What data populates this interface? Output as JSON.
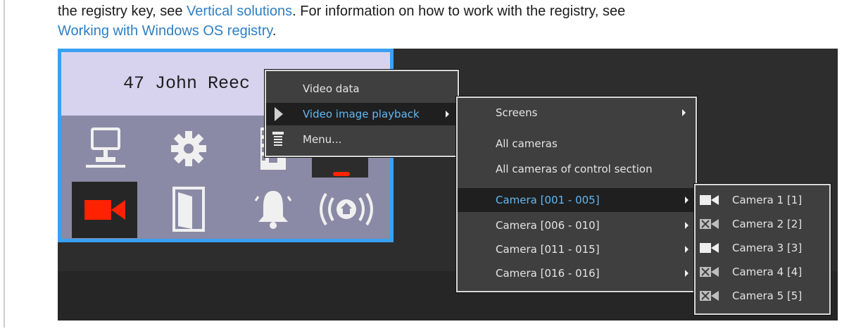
{
  "doc": {
    "line1_a": "the registry key, see ",
    "link1": "Vertical solutions",
    "line1_b": ". For information on how to work with the registry, see",
    "link2": "Working with Windows OS registry",
    "line2_end": "."
  },
  "panel": {
    "title": "47 John Reec",
    "icons": [
      "network-icon",
      "gear-icon",
      "film-icon",
      "video-camera-icon",
      "door-icon",
      "bell-icon",
      "alarm-broadcast-icon"
    ]
  },
  "menu1": {
    "items": [
      {
        "label": "Video data"
      },
      {
        "label": "Video image playback"
      },
      {
        "label": "Menu..."
      }
    ]
  },
  "menu2": {
    "items": [
      {
        "label": "Screens"
      },
      {
        "label": "All cameras"
      },
      {
        "label": "All cameras of control section"
      },
      {
        "label": "Camera [001 - 005]"
      },
      {
        "label": "Camera [006 - 010]"
      },
      {
        "label": "Camera [011 - 015]"
      },
      {
        "label": "Camera [016 - 016]"
      }
    ]
  },
  "menu3": {
    "items": [
      {
        "label": "Camera 1 [1]",
        "icon": "camera-icon"
      },
      {
        "label": "Camera 2 [2]",
        "icon": "camera-disabled-icon"
      },
      {
        "label": "Camera 3 [3]",
        "icon": "camera-icon"
      },
      {
        "label": "Camera 4 [4]",
        "icon": "camera-disabled-icon"
      },
      {
        "label": "Camera 5 [5]",
        "icon": "camera-disabled-icon"
      }
    ]
  },
  "colors": {
    "link": "#2d7fc4",
    "panel_border": "#3aa0f2",
    "active_menu_text": "#62b8f4",
    "camera_red": "#ff2200"
  }
}
